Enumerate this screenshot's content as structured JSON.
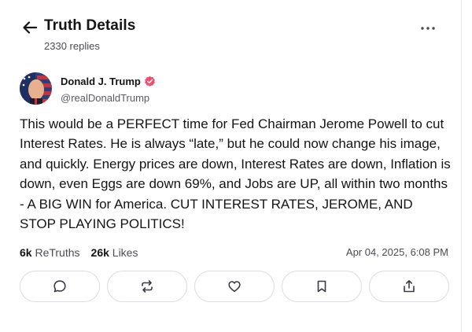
{
  "header": {
    "title": "Truth Details",
    "replies": "2330 replies"
  },
  "post": {
    "author": {
      "name": "Donald J. Trump",
      "handle": "@realDonaldTrump",
      "verified_color": "#ef4f6b"
    },
    "text": "This would be a PERFECT time for Fed Chairman Jerome Powell to cut Interest Rates. He is always “late,” but he could now change his image, and quickly. Energy prices are down, Interest Rates are down, Inflation is down, even Eggs are down 69%, and Jobs are UP, all within two months - A BIG WIN for America. CUT INTEREST RATES, JEROME, AND STOP PLAYING POLITICS!",
    "stats": {
      "retruths_count": "6k",
      "retruths_label": "ReTruths",
      "likes_count": "26k",
      "likes_label": "Likes"
    },
    "timestamp": "Apr 04, 2025, 6:08 PM"
  },
  "actions": [
    {
      "icon": "reply-icon"
    },
    {
      "icon": "retruth-icon"
    },
    {
      "icon": "like-icon"
    },
    {
      "icon": "bookmark-icon"
    },
    {
      "icon": "share-icon"
    }
  ]
}
